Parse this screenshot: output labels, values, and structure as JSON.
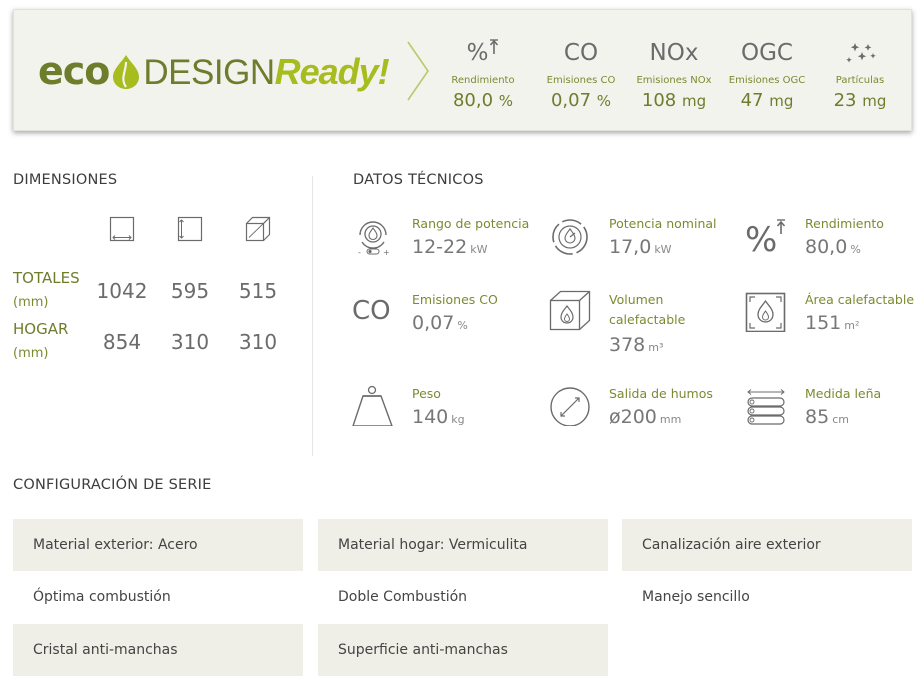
{
  "eco_banner": {
    "logo": {
      "eco": "eco",
      "design": "DESIGN",
      "ready": "Ready!"
    },
    "items": [
      {
        "symbol": "%",
        "label": "Rendimiento",
        "value": "80,0",
        "unit": "%"
      },
      {
        "symbol": "CO",
        "label": "Emisiones CO",
        "value": "0,07",
        "unit": "%"
      },
      {
        "symbol": "NOx",
        "label": "Emisiones NOx",
        "value": "108",
        "unit": "mg"
      },
      {
        "symbol": "OGC",
        "label": "Emisiones OGC",
        "value": "47",
        "unit": "mg"
      },
      {
        "symbol": "",
        "label": "Partículas",
        "value": "23",
        "unit": "mg"
      }
    ]
  },
  "dimensions": {
    "title": "DIMENSIONES",
    "rows": [
      {
        "label": "TOTALES",
        "unit": "(mm)",
        "values": [
          "1042",
          "595",
          "515"
        ]
      },
      {
        "label": "HOGAR",
        "unit": "(mm)",
        "values": [
          "854",
          "310",
          "310"
        ]
      }
    ]
  },
  "technical": {
    "title": "DATOS TÉCNICOS",
    "items": [
      {
        "icon": "power-range-icon",
        "label": "Rango de potencia",
        "value": "12-22",
        "unit": "kW"
      },
      {
        "icon": "nominal-power-icon",
        "label": "Potencia nominal",
        "value": "17,0",
        "unit": "kW"
      },
      {
        "icon": "efficiency-icon",
        "label": "Rendimiento",
        "value": "80,0",
        "unit": "%"
      },
      {
        "icon": "co-text-icon",
        "icon_text": "CO",
        "label": "Emisiones CO",
        "value": "0,07",
        "unit": "%"
      },
      {
        "icon": "heated-volume-icon",
        "label": "Volumen",
        "label2": "calefactable",
        "value": "378",
        "unit": "m³"
      },
      {
        "icon": "heated-area-icon",
        "label": "Área calefactable",
        "value": "151",
        "unit": "m²"
      },
      {
        "icon": "weight-icon",
        "label": "Peso",
        "value": "140",
        "unit": "kg"
      },
      {
        "icon": "smoke-outlet-icon",
        "label": "Salida de humos",
        "value": "ø200",
        "unit": "mm"
      },
      {
        "icon": "firewood-icon",
        "label": "Medida leña",
        "value": "85",
        "unit": "cm"
      }
    ]
  },
  "configuration": {
    "title": "CONFIGURACIÓN DE SERIE",
    "items": [
      "Material exterior: Acero",
      "Material hogar: Vermiculita",
      "Canalización aire exterior",
      "Óptima combustión",
      "Doble Combustión",
      "Manejo sencillo",
      "Cristal anti-manchas",
      "Superficie anti-manchas"
    ]
  }
}
